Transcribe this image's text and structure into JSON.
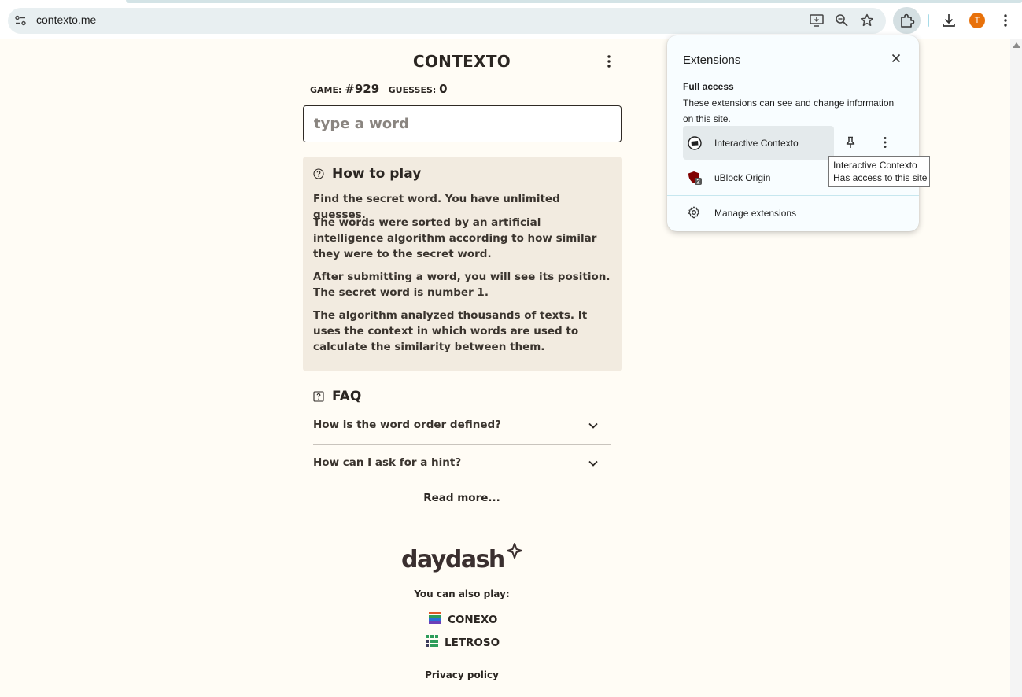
{
  "browser": {
    "url": "contexto.me",
    "avatar_letter": "T",
    "icons": [
      "site-info-icon",
      "install-app-icon",
      "zoom-icon",
      "bookmark-star-icon",
      "extensions-icon",
      "downloads-icon",
      "chrome-menu-icon"
    ]
  },
  "page": {
    "title": "CONTEXTO",
    "game_label": "GAME:",
    "game_number": "#929",
    "guesses_label": "GUESSES:",
    "guesses_count": "0",
    "input_placeholder": "type a word",
    "howto": {
      "title": "How to play",
      "paragraphs": [
        "Find the secret word. You have unlimited guesses.",
        "The words were sorted by an artificial intelligence algorithm according to how similar they were to the secret word.",
        "After submitting a word, you will see its position. The secret word is number 1.",
        "The algorithm analyzed thousands of texts. It uses the context in which words are used to calculate the similarity between them."
      ]
    },
    "faq": {
      "title": "FAQ",
      "questions": [
        "How is the word order defined?",
        "How can I ask for a hint?"
      ],
      "read_more": "Read more..."
    },
    "footer": {
      "brand": "daydash",
      "also_play": "You can also play:",
      "games": [
        "CONEXO",
        "LETROSO"
      ],
      "privacy": "Privacy policy"
    }
  },
  "extensions_panel": {
    "title": "Extensions",
    "section": "Full access",
    "description": "These extensions can see and change information on this site.",
    "items": [
      {
        "name": "Interactive Contexto"
      },
      {
        "name": "uBlock Origin",
        "badge": "2"
      }
    ],
    "manage": "Manage extensions",
    "tooltip_line1": "Interactive Contexto",
    "tooltip_line2": "Has access to this site"
  },
  "colors": {
    "page_bg": "#fffcf5",
    "howto_bg": "#f2ebe0",
    "text": "#2b2622",
    "avatar": "#e8710a",
    "panel_bg": "#f8fdff"
  }
}
